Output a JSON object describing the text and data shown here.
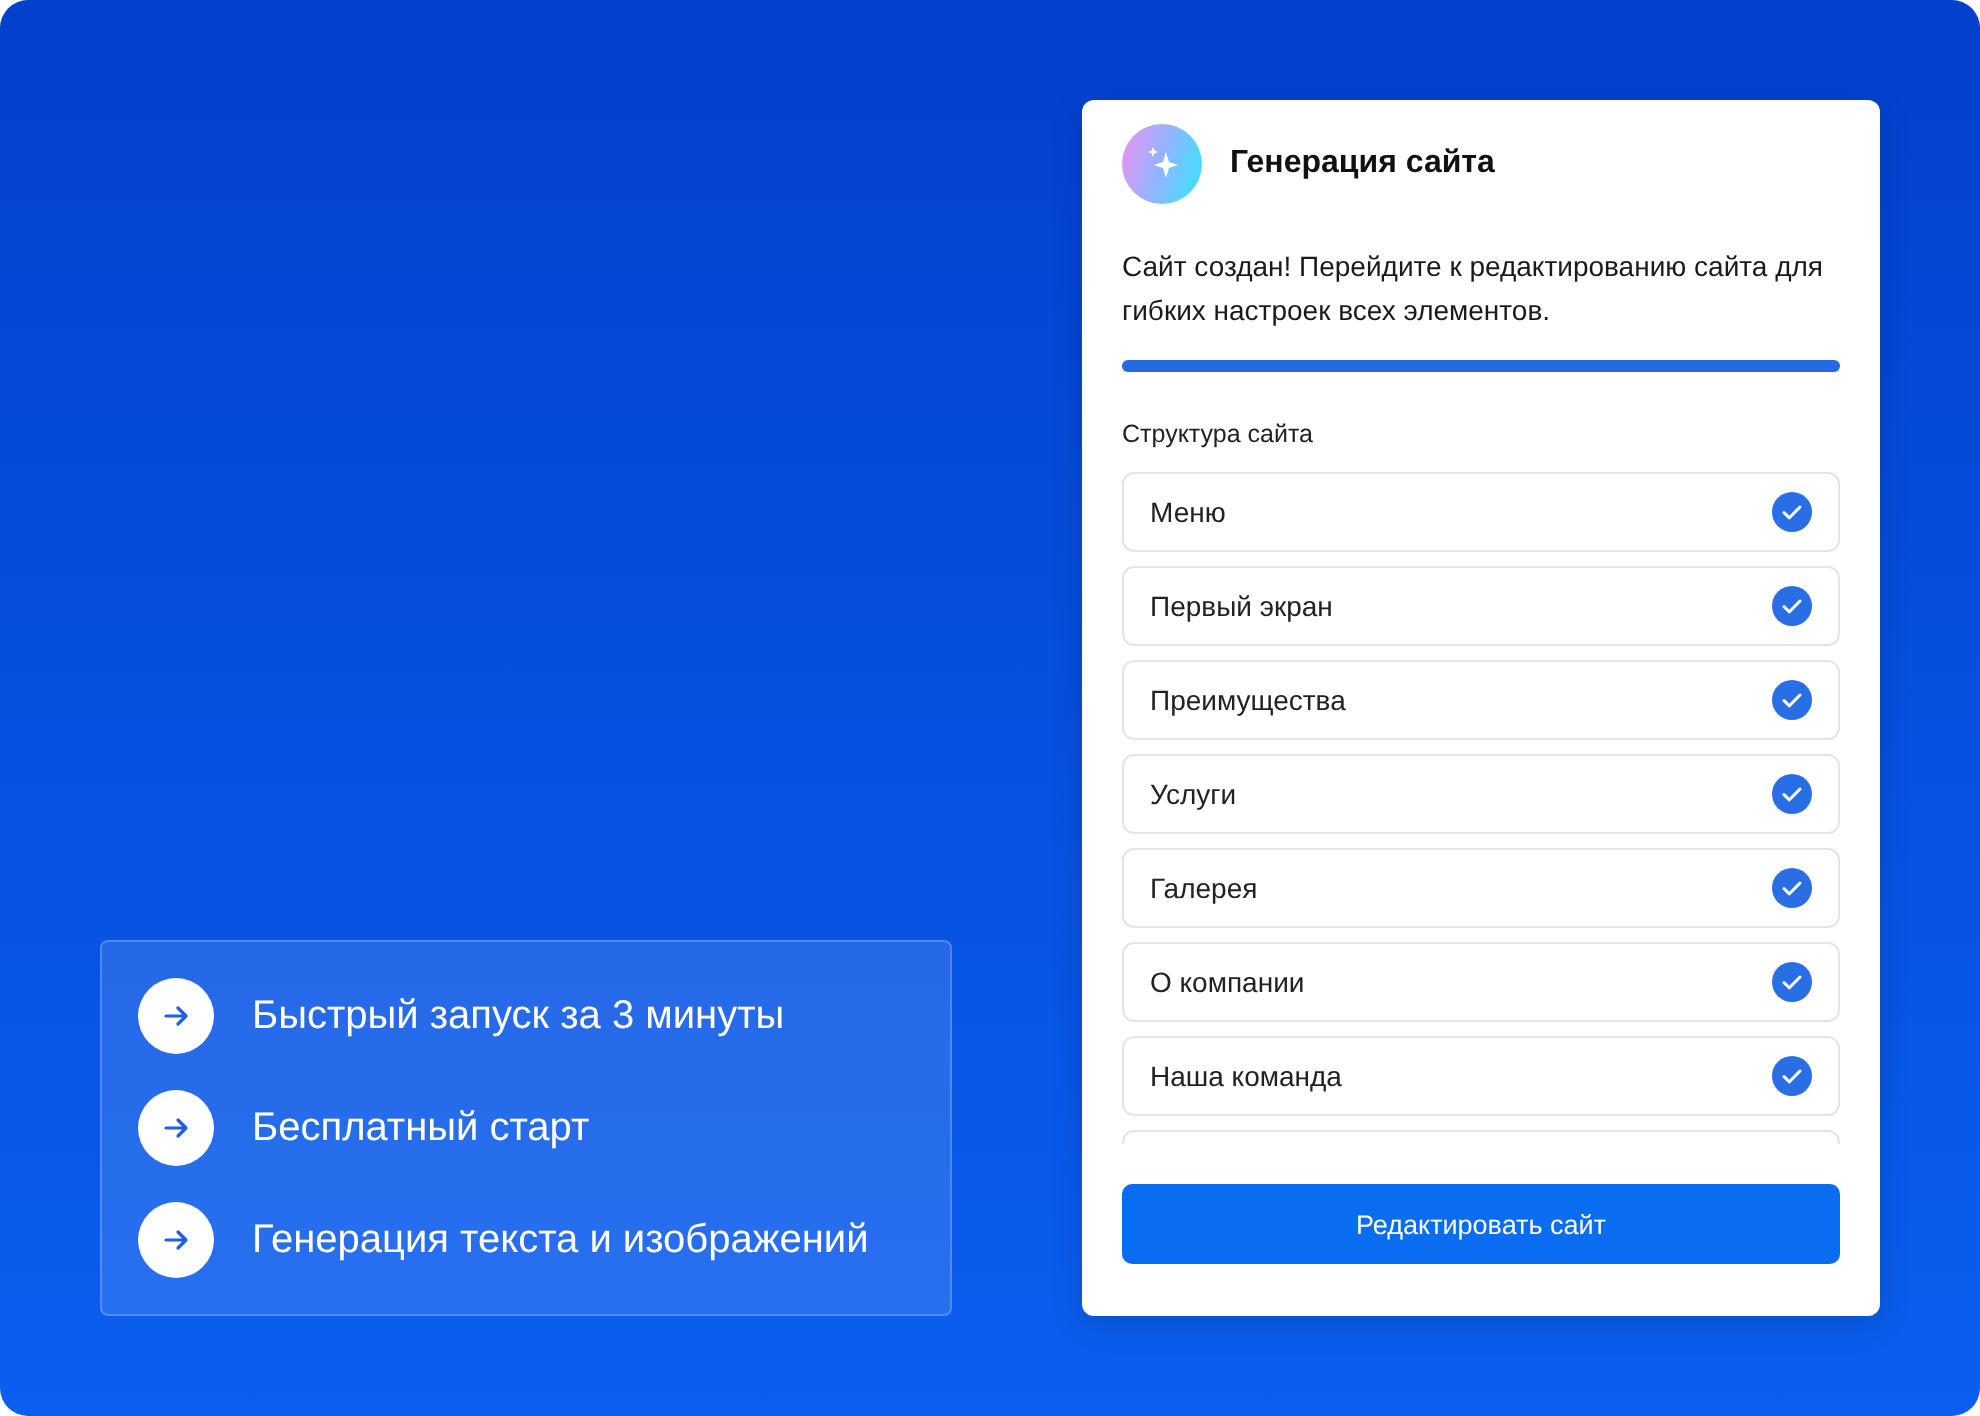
{
  "features": [
    {
      "label": "Быстрый запуск за 3 минуты"
    },
    {
      "label": "Бесплатный старт"
    },
    {
      "label": "Генерация текста и изображений"
    }
  ],
  "card": {
    "title": "Генерация сайта",
    "message": "Сайт создан! Перейдите к редактированию сайта для гибких настроек всех элементов.",
    "progress": {
      "level": 1
    },
    "section_title": "Структура сайта",
    "items": [
      {
        "label": "Меню",
        "checked": true
      },
      {
        "label": "Первый экран",
        "checked": true
      },
      {
        "label": "Преимущества",
        "checked": true
      },
      {
        "label": "Услуги",
        "checked": true
      },
      {
        "label": "Галерея",
        "checked": true
      },
      {
        "label": "О компании",
        "checked": true
      },
      {
        "label": "Наша команда",
        "checked": true
      }
    ],
    "button": "Редактировать сайт"
  }
}
